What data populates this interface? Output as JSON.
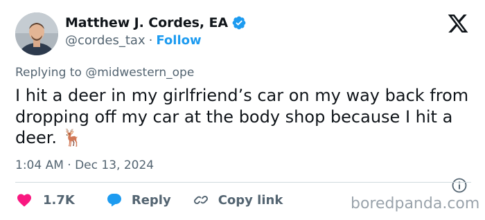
{
  "author": {
    "name": "Matthew J. Cordes, EA",
    "handle": "@cordes_tax",
    "separator": "·",
    "follow_label": "Follow"
  },
  "replying_to": {
    "prefix": "Replying to ",
    "mention": "@midwestern_ope"
  },
  "tweet": {
    "text": "I hit a deer in my girlfriend’s car on my way back from dropping off my car at the body shop because I hit a deer. 🦌",
    "timestamp": "1:04 AM · Dec 13, 2024"
  },
  "actions": {
    "likes_count": "1.7K",
    "reply_label": "Reply",
    "copy_link_label": "Copy link"
  },
  "watermark": "boredpanda.com",
  "colors": {
    "accent": "#1d9bf0",
    "like": "#f91880",
    "muted": "#536471",
    "text": "#0f1419"
  },
  "icons": [
    "verified-badge-icon",
    "x-logo-icon",
    "info-icon",
    "heart-icon",
    "reply-bubble-icon",
    "link-icon"
  ]
}
